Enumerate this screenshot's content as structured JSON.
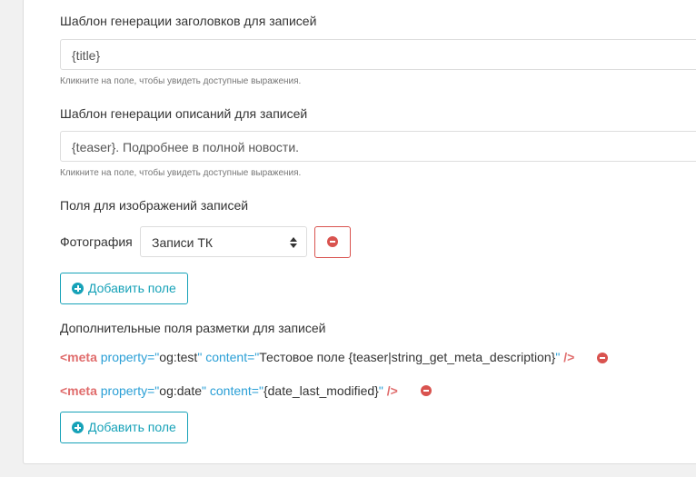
{
  "title_template": {
    "label": "Шаблон генерации заголовков для записей",
    "value": "{title}",
    "hint": "Кликните на поле, чтобы увидеть доступные выражения."
  },
  "description_template": {
    "label": "Шаблон генерации описаний для записей",
    "value": "{teaser}. Подробнее в полной новости.",
    "hint": "Кликните на поле, чтобы увидеть доступные выражения."
  },
  "image_fields": {
    "label": "Поля для изображений записей",
    "row_label": "Фотография",
    "select_value": "Записи ТК",
    "add_button": "Добавить поле"
  },
  "meta_fields": {
    "label": "Дополнительные поля разметки для записей",
    "rows": [
      {
        "open": "<meta",
        "attr1": "property=",
        "val1": "og:test",
        "attr2": "content=",
        "val2": "Тестовое поле {teaser|string_get_meta_description}",
        "close": "/>"
      },
      {
        "open": "<meta",
        "attr1": "property=",
        "val1": "og:date",
        "attr2": "content=",
        "val2": "{date_last_modified}",
        "close": "/>"
      }
    ],
    "add_button": "Добавить поле",
    "quote": "\""
  },
  "colors": {
    "danger": "#d9534f",
    "info": "#17a2b8"
  }
}
